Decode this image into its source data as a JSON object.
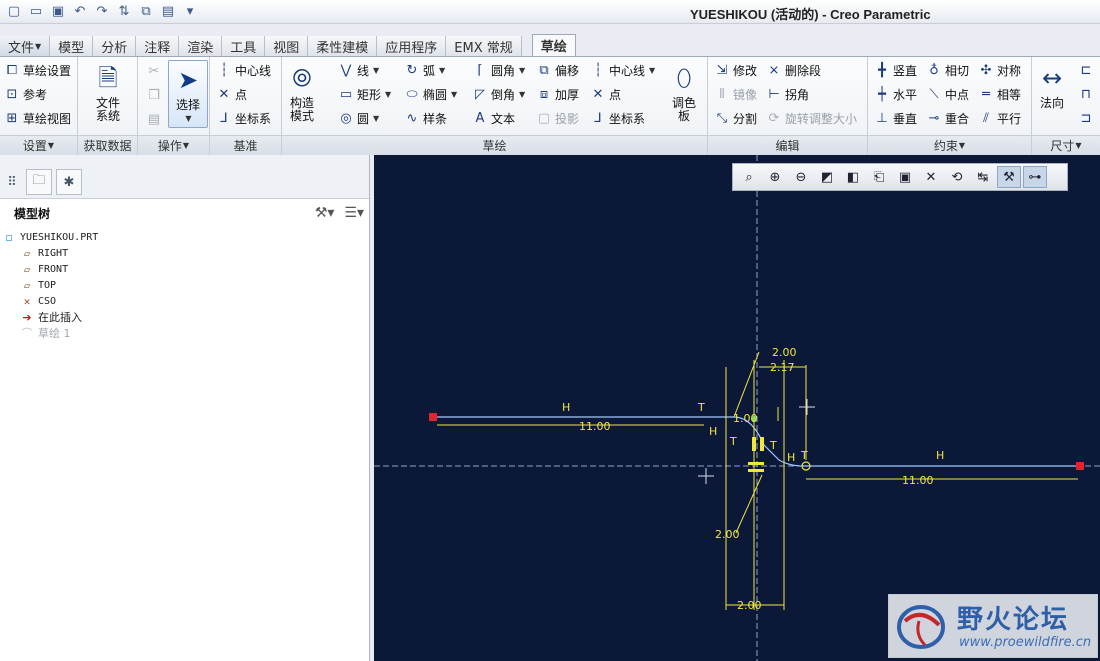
{
  "window": {
    "title": "YUESHIKOU (活动的) - Creo Parametric"
  },
  "quick_access": [
    "new-icon",
    "open-icon",
    "save-icon",
    "undo-icon",
    "redo-icon",
    "regenerate-icon",
    "windows-icon",
    "close-icon",
    "customize-icon"
  ],
  "tabs": [
    {
      "label": "文件"
    },
    {
      "label": "模型"
    },
    {
      "label": "分析"
    },
    {
      "label": "注释"
    },
    {
      "label": "渲染"
    },
    {
      "label": "工具"
    },
    {
      "label": "视图"
    },
    {
      "label": "柔性建模"
    },
    {
      "label": "应用程序"
    },
    {
      "label": "EMX 常规"
    },
    {
      "label": "草绘"
    }
  ],
  "ribbon": {
    "setup": {
      "group": "设置",
      "items": [
        "草绘设置",
        "参考",
        "草绘视图"
      ]
    },
    "get_data": {
      "group": "获取数据",
      "file_system": "文件\n系统"
    },
    "operations": {
      "group": "操作",
      "select": "选择"
    },
    "datum": {
      "group": "基准",
      "items": [
        "中心线",
        "点",
        "坐标系"
      ]
    },
    "sketching": {
      "group": "草绘",
      "construction_mode": "构造\n模式",
      "col1": [
        "线",
        "矩形",
        "圆"
      ],
      "col2": [
        "弧",
        "椭圆",
        "样条"
      ],
      "col3": [
        "圆角",
        "倒角",
        "文本"
      ],
      "col4": [
        "偏移",
        "加厚",
        "投影"
      ],
      "col5": [
        "中心线",
        "点",
        "坐标系"
      ],
      "palette": "调色\n板"
    },
    "editing": {
      "group": "编辑",
      "col1": [
        "修改",
        "镜像",
        "分割"
      ],
      "col2": [
        "删除段",
        "拐角",
        "旋转调整大小"
      ]
    },
    "constrain": {
      "group": "约束",
      "col1": [
        "竖直",
        "水平",
        "垂直"
      ],
      "col2": [
        "相切",
        "中点",
        "重合"
      ],
      "col3": [
        "对称",
        "相等",
        "平行"
      ]
    },
    "dimension": {
      "group": "尺寸",
      "normal": "法向"
    }
  },
  "model_tree": {
    "title": "模型树",
    "nodes": [
      {
        "label": "YUESHIKOU.PRT",
        "icon": "part-icon"
      },
      {
        "label": "RIGHT",
        "icon": "datum-plane-icon"
      },
      {
        "label": "FRONT",
        "icon": "datum-plane-icon"
      },
      {
        "label": "TOP",
        "icon": "datum-plane-icon"
      },
      {
        "label": "CSO",
        "icon": "coordinate-system-icon"
      },
      {
        "label": "在此插入",
        "icon": "insert-here-arrow-icon"
      },
      {
        "label": "草绘 1",
        "icon": "sketch-icon",
        "greyed": true
      }
    ]
  },
  "sketch": {
    "dims": [
      "2.00",
      "2.17",
      "11.00",
      "1.00",
      "11.00",
      "2.00",
      "2.00"
    ],
    "constraints": [
      "H",
      "T",
      "H",
      "T",
      "T",
      "H",
      "T",
      "H"
    ],
    "colors": {
      "background": "#0b1837",
      "geometry": "#9ec7ff",
      "dimension": "#f0e63c",
      "axis": "#8fa3c8",
      "endpoint": "#e0262a"
    }
  },
  "watermark": {
    "cn": "野火论坛",
    "url": "www.proewildfire.cn"
  }
}
